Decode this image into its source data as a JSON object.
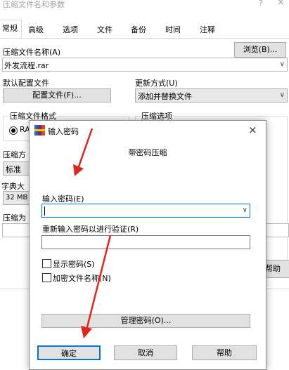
{
  "main_window": {
    "title": "压缩文件名和参数",
    "title_help": "?",
    "title_close": "×",
    "tabs": [
      "常规",
      "高级",
      "选项",
      "文件",
      "备份",
      "时间",
      "注释"
    ],
    "archive_name_label": "压缩文件名称(A)",
    "browse_button": "浏览(B)...",
    "archive_name_value": "外发流程.rar",
    "default_profile_label": "默认配置文件",
    "profile_button": "配置文件(F)...",
    "update_mode_label": "更新方式(U)",
    "update_mode_value": "添加并替换文件",
    "archive_format_label": "压缩文件格式",
    "archive_format_option": "RA",
    "archive_options_label": "压缩选项",
    "compression_method_label": "压缩方",
    "compression_method_value": "标准",
    "dictionary_label": "字典大",
    "dictionary_value": "32 MB",
    "split_label": "压缩为",
    "help_button": "帮助"
  },
  "password_dialog": {
    "title": "输入密码",
    "close": "×",
    "heading": "带密码压缩",
    "enter_password_label": "输入密码(E)",
    "enter_password_value": "",
    "reenter_password_label": "重新输入密码以进行验证(R)",
    "reenter_password_value": "",
    "show_password_label": "显示密码(S)",
    "encrypt_names_label": "加密文件名称(N)",
    "manage_passwords_button": "管理密码(O)...",
    "ok_button": "确定",
    "cancel_button": "取消",
    "help_button": "帮助"
  }
}
